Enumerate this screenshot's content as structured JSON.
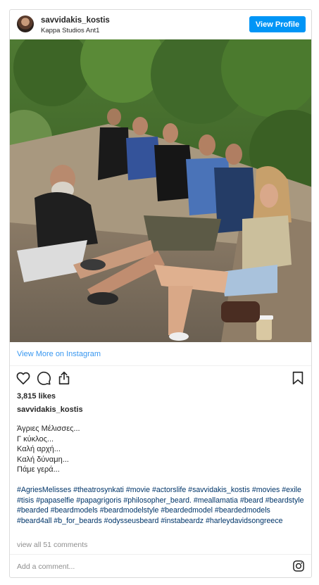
{
  "header": {
    "username": "savvidakis_kostis",
    "location": "Kappa Studios Ant1",
    "view_profile_label": "View Profile"
  },
  "photo": {
    "icon": "group-photo-image"
  },
  "view_more_label": "View More on Instagram",
  "actions": {
    "like_icon": "heart-icon",
    "comment_icon": "comment-icon",
    "share_icon": "share-icon",
    "save_icon": "bookmark-icon"
  },
  "likes": "3,815 likes",
  "caption": {
    "username": "savvidakis_kostis",
    "lines": [
      "Άγριες Μέλισσες...",
      "Γ κύκλος...",
      "Καλή αρχή...",
      "Καλή δύναμη...",
      "Πάμε γερά..."
    ],
    "hashtags": "#AgriesMelisses #theatrosynkati #movie #actorslife #savvidakis_kostis #movies #exile #tisis #papaselfie #papagrigoris #philosopher_beard. #meallamatia #beard #beardstyle #bearded #beardmodels #beardmodelstyle #beardedmodel #beardedmodels #beard4all #b_for_beards #odysseusbeard #instabeardz #harleydavidsongreece"
  },
  "comments_link": "view all 51 comments",
  "add_comment_placeholder": "Add a comment...",
  "instagram_icon": "instagram-icon",
  "colors": {
    "accent": "#0095f6",
    "link": "#3897f0",
    "hashtag": "#003569",
    "muted": "#8e8e8e",
    "border": "#dbdbdb"
  }
}
